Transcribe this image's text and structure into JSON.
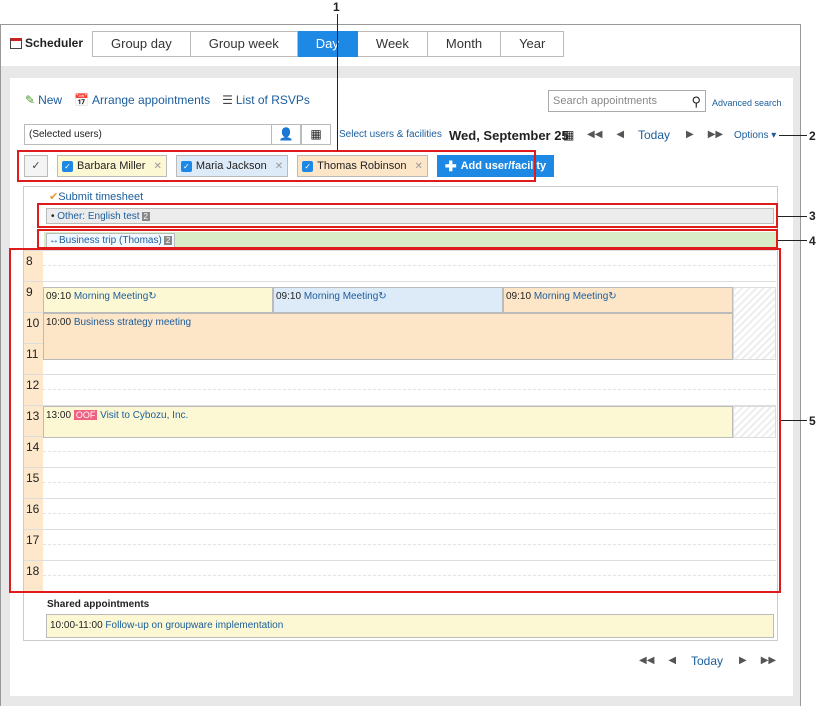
{
  "app": {
    "name": "Scheduler"
  },
  "tabs": [
    "Group day",
    "Group week",
    "Day",
    "Week",
    "Month",
    "Year"
  ],
  "actions": {
    "new": "New",
    "arrange": "Arrange appointments",
    "rsvp": "List of RSVPs"
  },
  "search": {
    "placeholder": "Search appointments",
    "advanced": "Advanced search"
  },
  "users": {
    "selected": "(Selected users)",
    "select_link": "Select users & facilities",
    "add": "Add user/facility",
    "chips": [
      "Barbara Miller",
      "Maria Jackson",
      "Thomas Robinson"
    ]
  },
  "date": "Wed, September 25",
  "nav": {
    "today": "Today",
    "options": "Options"
  },
  "callouts": [
    "1",
    "2",
    "3",
    "4",
    "5"
  ],
  "allday": {
    "timesheet": "Submit timesheet",
    "other": "Other: English test",
    "other_count": "2",
    "banner": "Business trip (Thomas)",
    "banner_count": "2"
  },
  "hours": [
    "8",
    "9",
    "10",
    "11",
    "12",
    "13",
    "14",
    "15",
    "16",
    "17",
    "18"
  ],
  "events": {
    "m1_time": "09:10",
    "m1_title": "Morning Meeting",
    "m2_time": "09:10",
    "m2_title": "Morning Meeting",
    "m3_time": "09:10",
    "m3_title": "Morning Meeting",
    "bs_time": "10:00",
    "bs_title": "Business strategy meeting",
    "vc_time": "13:00",
    "vc_tag": "OOF",
    "vc_title": "Visit to Cybozu, Inc."
  },
  "shared": {
    "label": "Shared appointments",
    "time": "10:00-11:00",
    "title": "Follow-up on groupware implementation"
  },
  "colors": {
    "accent": "#1e88e5",
    "red": "#e01b1b",
    "yellow": "#fdf8d4",
    "blue": "#ddeaf8",
    "orange": "#fde5c8",
    "green": "#d8ecc8"
  }
}
